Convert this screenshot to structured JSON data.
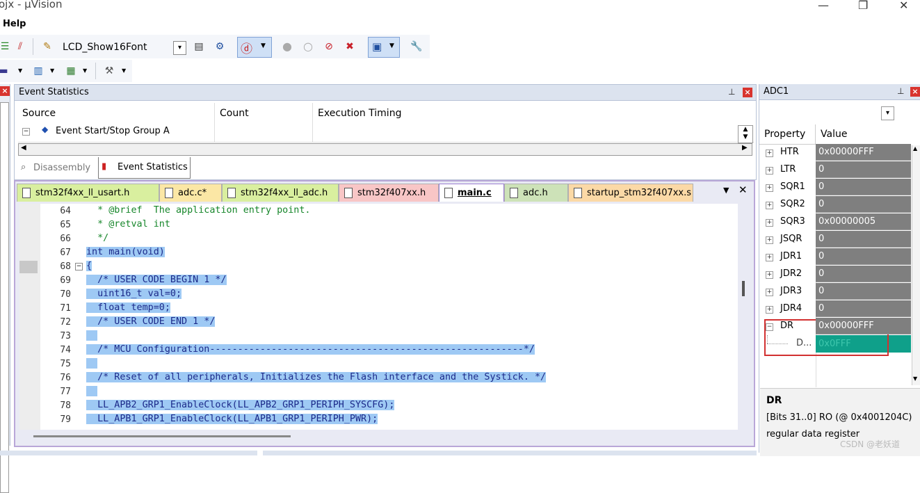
{
  "window": {
    "title": "ojx - µVision",
    "minimize": "—",
    "maximize": "❐",
    "close": "✕"
  },
  "menubar": {
    "items": [
      "Help"
    ]
  },
  "toolbar1": {
    "target_select": "LCD_Show16Font"
  },
  "event_stats": {
    "title": "Event Statistics",
    "columns": [
      "Source",
      "Count",
      "Execution Timing"
    ],
    "rows": [
      {
        "source": "Event Start/Stop Group A",
        "count": "",
        "timing": ""
      }
    ],
    "bottom_tabs": [
      "Disassembly",
      "Event Statistics"
    ]
  },
  "editor": {
    "tabs": [
      {
        "label": "stm32f4xx_ll_usart.h",
        "color": "#d9ef9f",
        "active": false
      },
      {
        "label": "adc.c*",
        "color": "#fbe7a5",
        "active": false
      },
      {
        "label": "stm32f4xx_ll_adc.h",
        "color": "#d9ef9f",
        "active": false
      },
      {
        "label": "stm32f407xx.h",
        "color": "#f8c6c6",
        "active": false
      },
      {
        "label": "main.c",
        "color": "#ffffff",
        "active": true
      },
      {
        "label": "adc.h",
        "color": "#cde2b8",
        "active": false
      },
      {
        "label": "startup_stm32f407xx.s",
        "color": "#fbd9a6",
        "active": false
      }
    ],
    "lines": [
      {
        "num": "64",
        "text": "  * @brief  The application entry point.",
        "kind": "cmt",
        "sel": false
      },
      {
        "num": "65",
        "text": "  * @retval int",
        "kind": "cmt",
        "sel": false
      },
      {
        "num": "66",
        "text": "  */",
        "kind": "cmt",
        "sel": false
      },
      {
        "num": "67",
        "text": "int main(void)",
        "kind": "dk",
        "sel": true
      },
      {
        "num": "68",
        "text": "{",
        "kind": "dk",
        "sel": true
      },
      {
        "num": "69",
        "text": "  /* USER CODE BEGIN 1 */",
        "kind": "dk",
        "sel": true
      },
      {
        "num": "70",
        "text": "  uint16_t val=0;",
        "kind": "dk",
        "sel": true
      },
      {
        "num": "71",
        "text": "  float temp=0;",
        "kind": "dk",
        "sel": true
      },
      {
        "num": "72",
        "text": "  /* USER CODE END 1 */",
        "kind": "dk",
        "sel": true
      },
      {
        "num": "73",
        "text": "  ",
        "kind": "dk",
        "sel": true
      },
      {
        "num": "74",
        "text": "  /* MCU Configuration--------------------------------------------------------*/",
        "kind": "dk",
        "sel": true
      },
      {
        "num": "75",
        "text": "  ",
        "kind": "dk",
        "sel": true
      },
      {
        "num": "76",
        "text": "  /* Reset of all peripherals, Initializes the Flash interface and the Systick. */",
        "kind": "dk",
        "sel": true
      },
      {
        "num": "77",
        "text": "  ",
        "kind": "dk",
        "sel": true
      },
      {
        "num": "78",
        "text": "  LL_APB2_GRP1_EnableClock(LL_APB2_GRP1_PERIPH_SYSCFG);",
        "kind": "dk",
        "sel": true
      },
      {
        "num": "79",
        "text": "  LL_APB1_GRP1_EnableClock(LL_APB1_GRP1_PERIPH_PWR);",
        "kind": "dk",
        "sel": true
      }
    ]
  },
  "adc": {
    "title": "ADC1",
    "columns": [
      "Property",
      "Value"
    ],
    "rows": [
      {
        "name": "HTR",
        "value": "0x00000FFF"
      },
      {
        "name": "LTR",
        "value": "0"
      },
      {
        "name": "SQR1",
        "value": "0"
      },
      {
        "name": "SQR2",
        "value": "0"
      },
      {
        "name": "SQR3",
        "value": "0x00000005"
      },
      {
        "name": "JSQR",
        "value": "0"
      },
      {
        "name": "JDR1",
        "value": "0"
      },
      {
        "name": "JDR2",
        "value": "0"
      },
      {
        "name": "JDR3",
        "value": "0"
      },
      {
        "name": "JDR4",
        "value": "0"
      },
      {
        "name": "DR",
        "value": "0x00000FFF"
      }
    ],
    "subrow": {
      "name": "D...",
      "value": "0x0FFF"
    },
    "desc": {
      "title": "DR",
      "bits": "[Bits 31..0] RO (@ 0x4001204C)",
      "text": "regular data register"
    },
    "watermark": "CSDN @老妖道"
  }
}
